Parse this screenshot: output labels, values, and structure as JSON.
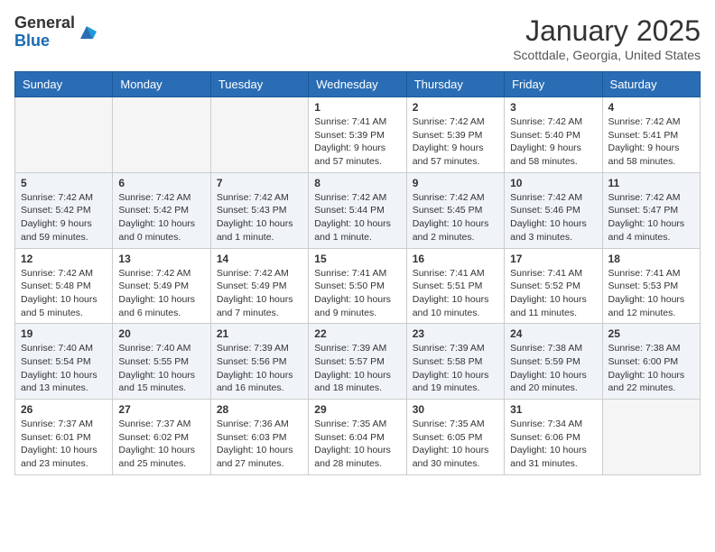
{
  "logo": {
    "general": "General",
    "blue": "Blue"
  },
  "title": "January 2025",
  "location": "Scottdale, Georgia, United States",
  "weekdays": [
    "Sunday",
    "Monday",
    "Tuesday",
    "Wednesday",
    "Thursday",
    "Friday",
    "Saturday"
  ],
  "weeks": [
    [
      {
        "day": "",
        "info": ""
      },
      {
        "day": "",
        "info": ""
      },
      {
        "day": "",
        "info": ""
      },
      {
        "day": "1",
        "info": "Sunrise: 7:41 AM\nSunset: 5:39 PM\nDaylight: 9 hours and 57 minutes."
      },
      {
        "day": "2",
        "info": "Sunrise: 7:42 AM\nSunset: 5:39 PM\nDaylight: 9 hours and 57 minutes."
      },
      {
        "day": "3",
        "info": "Sunrise: 7:42 AM\nSunset: 5:40 PM\nDaylight: 9 hours and 58 minutes."
      },
      {
        "day": "4",
        "info": "Sunrise: 7:42 AM\nSunset: 5:41 PM\nDaylight: 9 hours and 58 minutes."
      }
    ],
    [
      {
        "day": "5",
        "info": "Sunrise: 7:42 AM\nSunset: 5:42 PM\nDaylight: 9 hours and 59 minutes."
      },
      {
        "day": "6",
        "info": "Sunrise: 7:42 AM\nSunset: 5:42 PM\nDaylight: 10 hours and 0 minutes."
      },
      {
        "day": "7",
        "info": "Sunrise: 7:42 AM\nSunset: 5:43 PM\nDaylight: 10 hours and 1 minute."
      },
      {
        "day": "8",
        "info": "Sunrise: 7:42 AM\nSunset: 5:44 PM\nDaylight: 10 hours and 1 minute."
      },
      {
        "day": "9",
        "info": "Sunrise: 7:42 AM\nSunset: 5:45 PM\nDaylight: 10 hours and 2 minutes."
      },
      {
        "day": "10",
        "info": "Sunrise: 7:42 AM\nSunset: 5:46 PM\nDaylight: 10 hours and 3 minutes."
      },
      {
        "day": "11",
        "info": "Sunrise: 7:42 AM\nSunset: 5:47 PM\nDaylight: 10 hours and 4 minutes."
      }
    ],
    [
      {
        "day": "12",
        "info": "Sunrise: 7:42 AM\nSunset: 5:48 PM\nDaylight: 10 hours and 5 minutes."
      },
      {
        "day": "13",
        "info": "Sunrise: 7:42 AM\nSunset: 5:49 PM\nDaylight: 10 hours and 6 minutes."
      },
      {
        "day": "14",
        "info": "Sunrise: 7:42 AM\nSunset: 5:49 PM\nDaylight: 10 hours and 7 minutes."
      },
      {
        "day": "15",
        "info": "Sunrise: 7:41 AM\nSunset: 5:50 PM\nDaylight: 10 hours and 9 minutes."
      },
      {
        "day": "16",
        "info": "Sunrise: 7:41 AM\nSunset: 5:51 PM\nDaylight: 10 hours and 10 minutes."
      },
      {
        "day": "17",
        "info": "Sunrise: 7:41 AM\nSunset: 5:52 PM\nDaylight: 10 hours and 11 minutes."
      },
      {
        "day": "18",
        "info": "Sunrise: 7:41 AM\nSunset: 5:53 PM\nDaylight: 10 hours and 12 minutes."
      }
    ],
    [
      {
        "day": "19",
        "info": "Sunrise: 7:40 AM\nSunset: 5:54 PM\nDaylight: 10 hours and 13 minutes."
      },
      {
        "day": "20",
        "info": "Sunrise: 7:40 AM\nSunset: 5:55 PM\nDaylight: 10 hours and 15 minutes."
      },
      {
        "day": "21",
        "info": "Sunrise: 7:39 AM\nSunset: 5:56 PM\nDaylight: 10 hours and 16 minutes."
      },
      {
        "day": "22",
        "info": "Sunrise: 7:39 AM\nSunset: 5:57 PM\nDaylight: 10 hours and 18 minutes."
      },
      {
        "day": "23",
        "info": "Sunrise: 7:39 AM\nSunset: 5:58 PM\nDaylight: 10 hours and 19 minutes."
      },
      {
        "day": "24",
        "info": "Sunrise: 7:38 AM\nSunset: 5:59 PM\nDaylight: 10 hours and 20 minutes."
      },
      {
        "day": "25",
        "info": "Sunrise: 7:38 AM\nSunset: 6:00 PM\nDaylight: 10 hours and 22 minutes."
      }
    ],
    [
      {
        "day": "26",
        "info": "Sunrise: 7:37 AM\nSunset: 6:01 PM\nDaylight: 10 hours and 23 minutes."
      },
      {
        "day": "27",
        "info": "Sunrise: 7:37 AM\nSunset: 6:02 PM\nDaylight: 10 hours and 25 minutes."
      },
      {
        "day": "28",
        "info": "Sunrise: 7:36 AM\nSunset: 6:03 PM\nDaylight: 10 hours and 27 minutes."
      },
      {
        "day": "29",
        "info": "Sunrise: 7:35 AM\nSunset: 6:04 PM\nDaylight: 10 hours and 28 minutes."
      },
      {
        "day": "30",
        "info": "Sunrise: 7:35 AM\nSunset: 6:05 PM\nDaylight: 10 hours and 30 minutes."
      },
      {
        "day": "31",
        "info": "Sunrise: 7:34 AM\nSunset: 6:06 PM\nDaylight: 10 hours and 31 minutes."
      },
      {
        "day": "",
        "info": ""
      }
    ]
  ]
}
